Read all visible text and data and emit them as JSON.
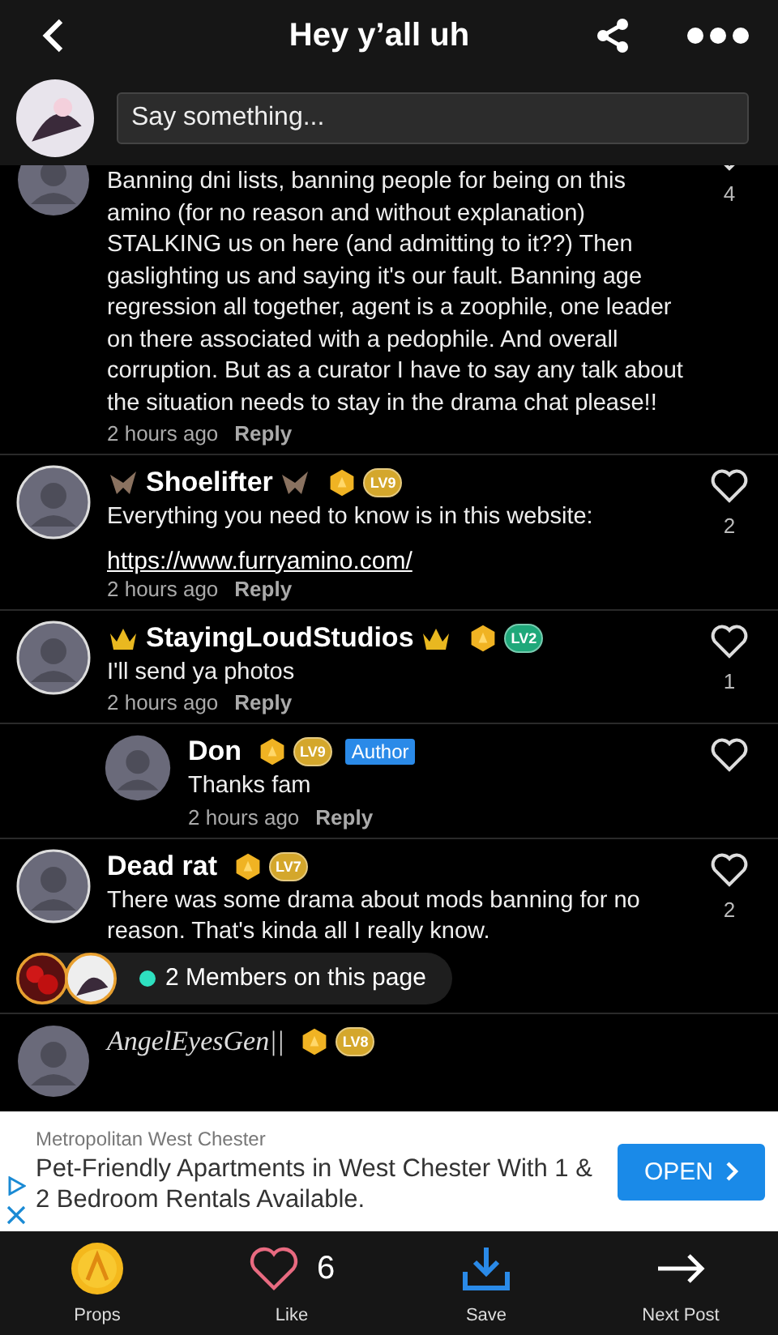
{
  "header": {
    "title": "Hey y’all uh"
  },
  "compose": {
    "placeholder": "Say something..."
  },
  "comments": [
    {
      "kind": "comment",
      "cut_top": true,
      "text": "Banning dni lists, banning people for being on this amino (for no reason and without explanation) STALKING us on here (and admitting to it??) Then gaslighting us and saying it's our fault. Banning age regression all together, agent is a zoophile, one leader on there associated with a pedophile. And overall corruption. But as a curator I have to say any talk about the situation needs to stay in the drama chat please!!",
      "time": "2 hours ago",
      "reply": "Reply",
      "likes": "4"
    },
    {
      "kind": "comment",
      "name": "Shoelifter",
      "deco": {
        "kind": "bat"
      },
      "level": "LV9",
      "color": "#d4a72c",
      "text": "Everything you need to know is in this website:",
      "link": "https://www.furryamino.com/",
      "time": "2 hours ago",
      "reply": "Reply",
      "likes": "2"
    },
    {
      "kind": "comment",
      "name": "StayingLoudStudios",
      "deco": {
        "kind": "crown"
      },
      "level": "LV2",
      "color": "#1fa87a",
      "text": "I'll send ya photos",
      "time": "2 hours ago",
      "reply": "Reply",
      "likes": "1"
    },
    {
      "kind": "reply",
      "name": "Don",
      "level": "LV9",
      "color": "#d4a72c",
      "tag": "Author",
      "text": "Thanks fam",
      "time": "2 hours ago",
      "reply": "Reply"
    },
    {
      "kind": "comment",
      "name": "Dead rat",
      "level": "LV7",
      "color": "#d4a72c",
      "text": "There was some drama about mods banning for no reason. That's kinda all I really know.",
      "likes": "2"
    },
    {
      "kind": "partial",
      "name": "AngelEyesGen||",
      "level": "LV8",
      "color": "#d4a72c"
    }
  ],
  "members": {
    "text": "2 Members on this page"
  },
  "ad": {
    "advertiser": "Metropolitan West Chester",
    "headline": "Pet-Friendly Apartments in West Chester With 1 & 2 Bedroom Rentals Available.",
    "button": "OPEN"
  },
  "toolbar": [
    {
      "kind": "props",
      "label": "Props"
    },
    {
      "kind": "like",
      "label": "Like",
      "count": "6"
    },
    {
      "kind": "save",
      "label": "Save"
    },
    {
      "kind": "next",
      "label": "Next Post"
    }
  ]
}
